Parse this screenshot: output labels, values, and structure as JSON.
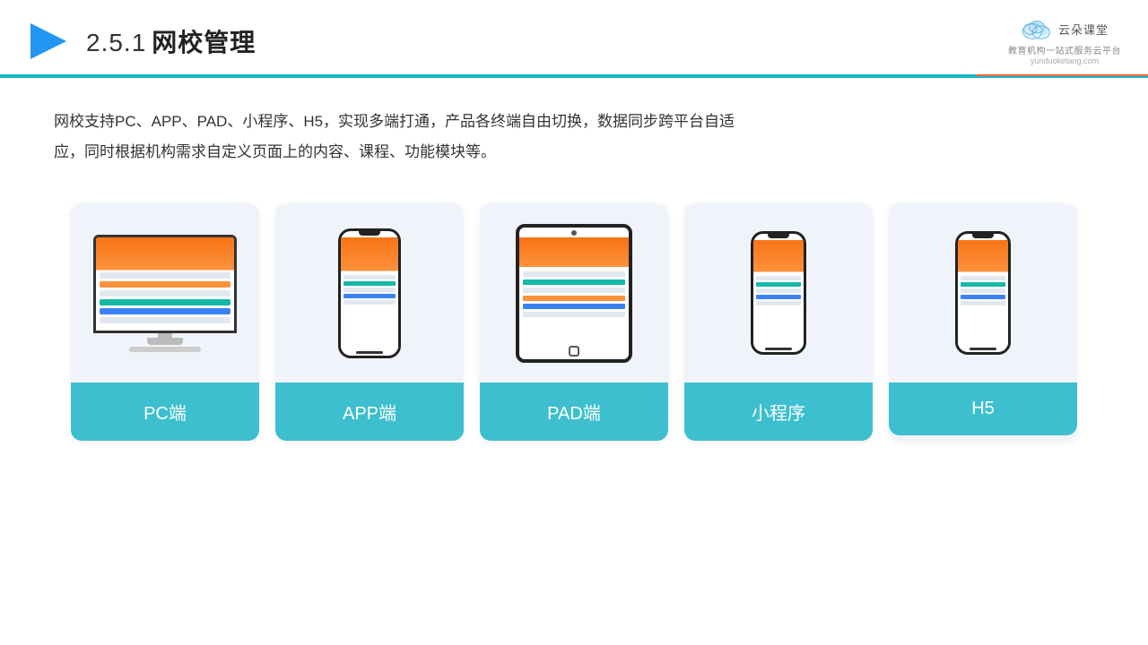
{
  "header": {
    "title_number": "2.5.1",
    "title_text": "网校管理",
    "logo_name": "云朵课堂",
    "logo_url": "yunduoketang.com",
    "logo_tagline": "教育机构一站\n式服务云平台"
  },
  "description": {
    "text": "网校支持PC、APP、PAD、小程序、H5，实现多端打通，产品各终端自由切换，数据同步跨平台自适应，同时根据机构需求自定义页面上的内容、课程、功能模块等。"
  },
  "cards": [
    {
      "id": "pc",
      "label": "PC端"
    },
    {
      "id": "app",
      "label": "APP端"
    },
    {
      "id": "pad",
      "label": "PAD端"
    },
    {
      "id": "miniapp",
      "label": "小程序"
    },
    {
      "id": "h5",
      "label": "H5"
    }
  ],
  "colors": {
    "accent_teal": "#3dbfcf",
    "header_line": "#1ab5c8"
  }
}
